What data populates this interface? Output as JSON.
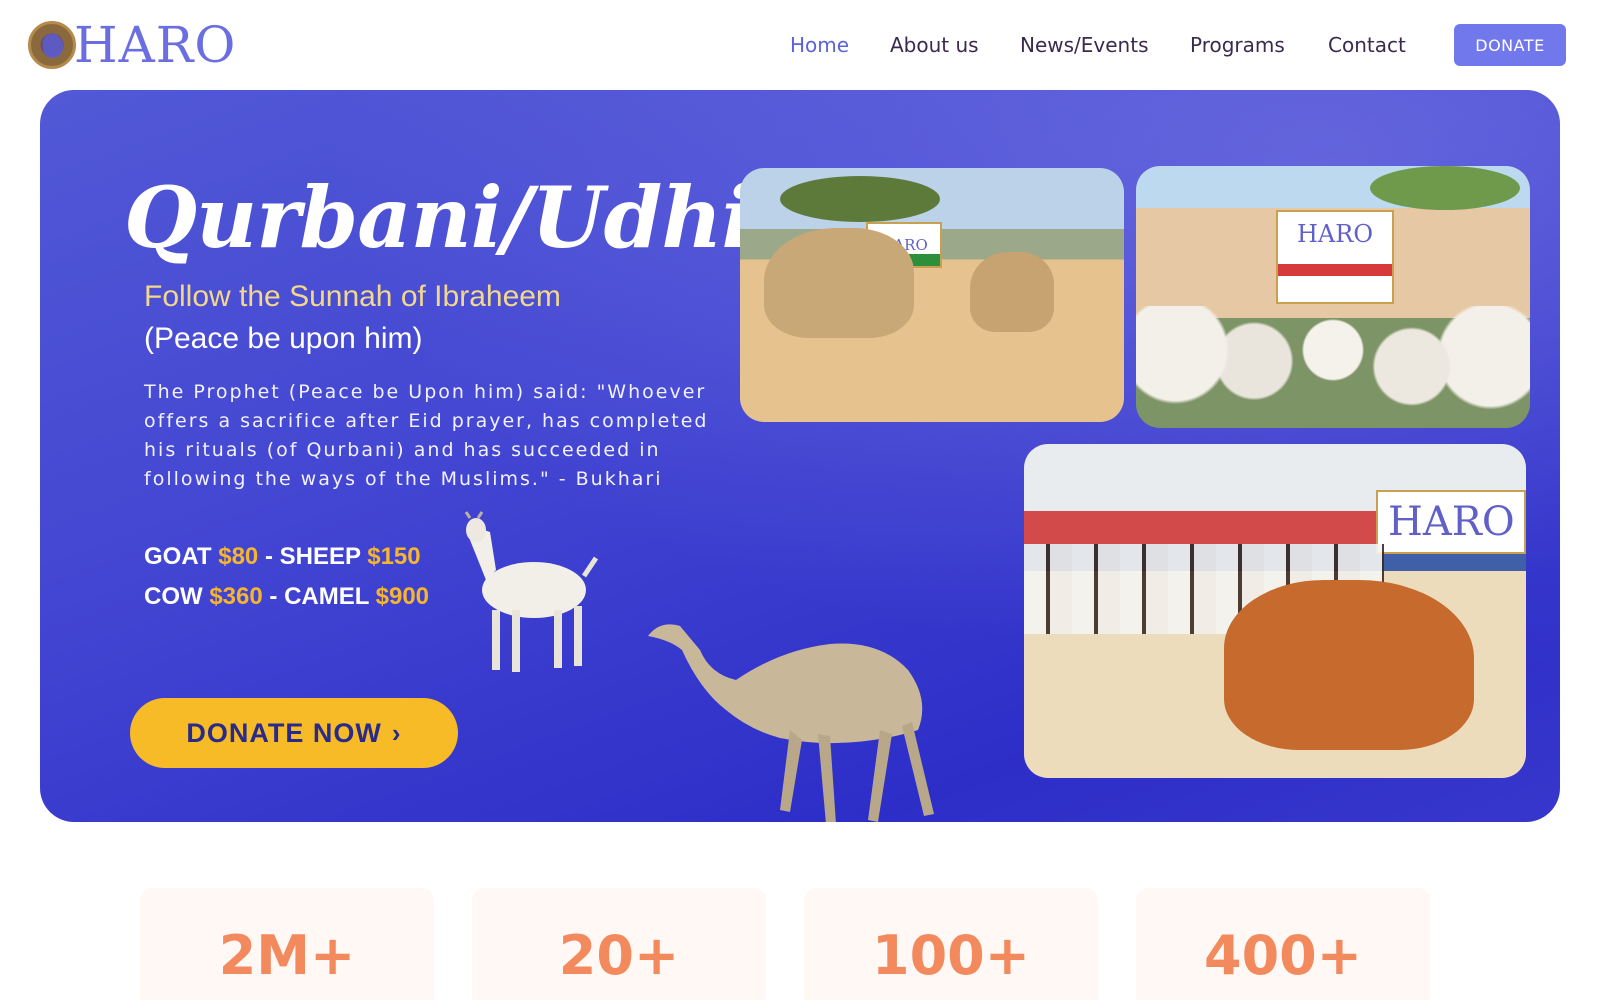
{
  "header": {
    "logo_text": "HARO",
    "nav": [
      "Home",
      "About us",
      "News/Events",
      "Programs",
      "Contact"
    ],
    "active_nav": "Home",
    "donate_label": "DONATE"
  },
  "hero": {
    "title": "Qurbani/Udhiya",
    "subtitle_line1": "Follow the Sunnah of Ibraheem",
    "subtitle_line2": "(Peace be upon him)",
    "quote": "The Prophet (Peace be Upon him) said: \"Whoever offers a sacrifice after Eid prayer, has completed his rituals (of Qurbani) and has succeeded in following the ways of the Muslims.\" - Bukhari",
    "prices": {
      "goat_label": "GOAT",
      "goat_amount": "$80",
      "sheep_label": "SHEEP",
      "sheep_amount": "$150",
      "cow_label": "COW",
      "cow_amount": "$360",
      "camel_label": "CAMEL",
      "camel_amount": "$900"
    },
    "cta_label": "DONATE NOW",
    "photo_sign_text": "HARO"
  },
  "stats": [
    "2M+",
    "20+",
    "100+",
    "400+"
  ],
  "colors": {
    "brand": "#6a6ee0",
    "hero_gradient_start": "#5259d6",
    "hero_gradient_end": "#2d2ec8",
    "cta": "#f6bb26",
    "price_accent": "#f6b52e",
    "stat_number": "#f28a5e"
  }
}
